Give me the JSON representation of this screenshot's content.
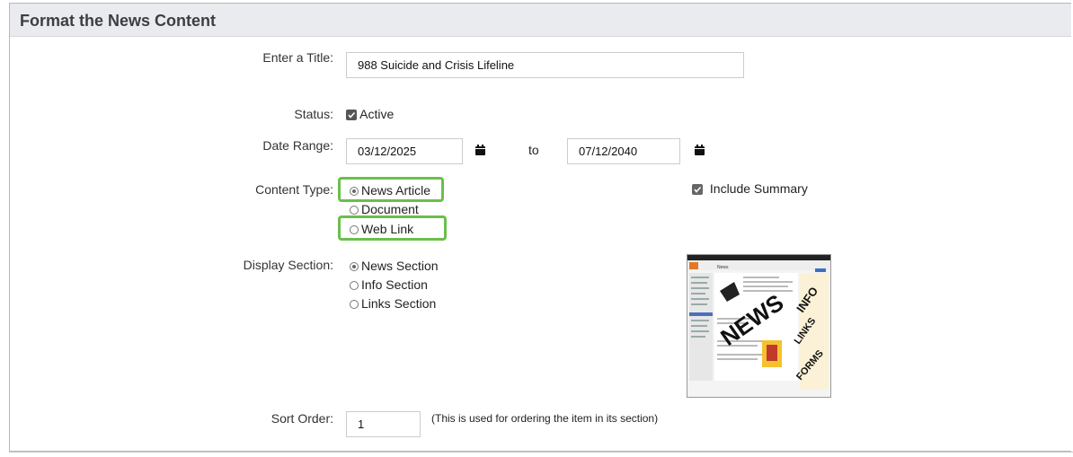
{
  "panel": {
    "title": "Format the News Content"
  },
  "form": {
    "title": {
      "label": "Enter a Title:",
      "value": "988 Suicide and Crisis Lifeline"
    },
    "status": {
      "label": "Status:",
      "option": "Active",
      "checked": true
    },
    "date_range": {
      "label": "Date Range:",
      "start": "03/12/2025",
      "separator": "to",
      "end": "07/12/2040"
    },
    "content_type": {
      "label": "Content Type:",
      "options": [
        "News Article",
        "Document",
        "Web Link"
      ],
      "selected": "News Article",
      "include_summary": {
        "label": "Include Summary",
        "checked": true
      }
    },
    "display_section": {
      "label": "Display Section:",
      "options": [
        "News Section",
        "Info Section",
        "Links Section"
      ],
      "selected": "News Section"
    },
    "sort_order": {
      "label": "Sort Order:",
      "value": "1",
      "note": "(This is used for ordering the item in its section)"
    }
  },
  "preview": {
    "words": [
      "NEWS",
      "INFO",
      "LINKS",
      "FORMS"
    ],
    "page_heading": "News"
  },
  "colors": {
    "highlight": "#6abf4b",
    "header_bg": "#e9ebee"
  }
}
